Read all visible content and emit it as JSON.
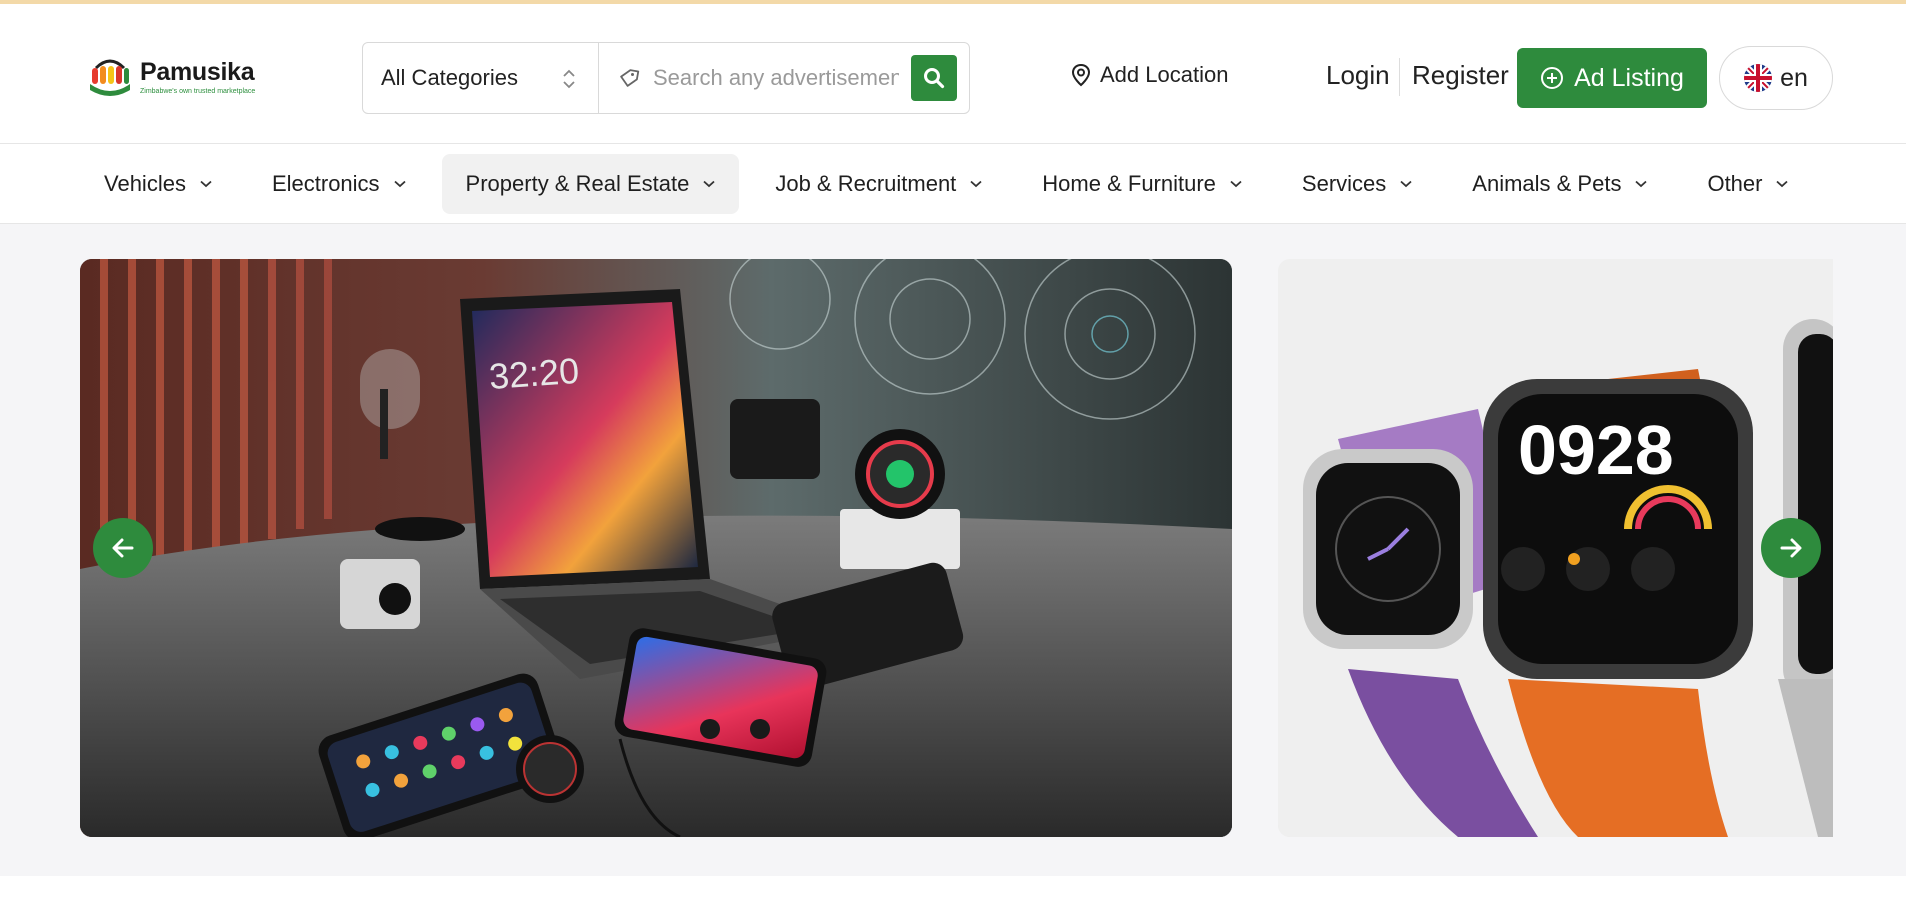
{
  "header": {
    "logo": {
      "name": "Pamusika",
      "tagline": "Zimbabwe's own trusted marketplace"
    },
    "search": {
      "category_selected": "All Categories",
      "placeholder": "Search any advertisement"
    },
    "add_location_label": "Add Location",
    "login_label": "Login",
    "register_label": "Register",
    "ad_listing_label": "Ad Listing",
    "language_label": "en"
  },
  "nav": {
    "items": [
      {
        "label": "Vehicles",
        "active": false
      },
      {
        "label": "Electronics",
        "active": false
      },
      {
        "label": "Property & Real Estate",
        "active": true
      },
      {
        "label": "Job & Recruitment",
        "active": false
      },
      {
        "label": "Home & Furniture",
        "active": false
      },
      {
        "label": "Services",
        "active": false
      },
      {
        "label": "Animals & Pets",
        "active": false
      },
      {
        "label": "Other",
        "active": false
      }
    ]
  },
  "hero": {
    "main_slide_clock": "32:20",
    "side_slide_watch_time": "0928"
  },
  "colors": {
    "brand_green": "#2e8b3d",
    "top_line": "#f3d9a8",
    "hero_bg": "#f5f5f7"
  },
  "icons": {
    "category_select": "sort-arrows-icon",
    "search_field": "tag-icon",
    "search_button": "search-icon",
    "location": "map-pin-icon",
    "ad_listing": "plus-circle-icon",
    "language": "uk-flag-icon",
    "nav_dropdown": "chevron-down-icon",
    "prev": "arrow-left-icon",
    "next": "arrow-right-icon"
  }
}
